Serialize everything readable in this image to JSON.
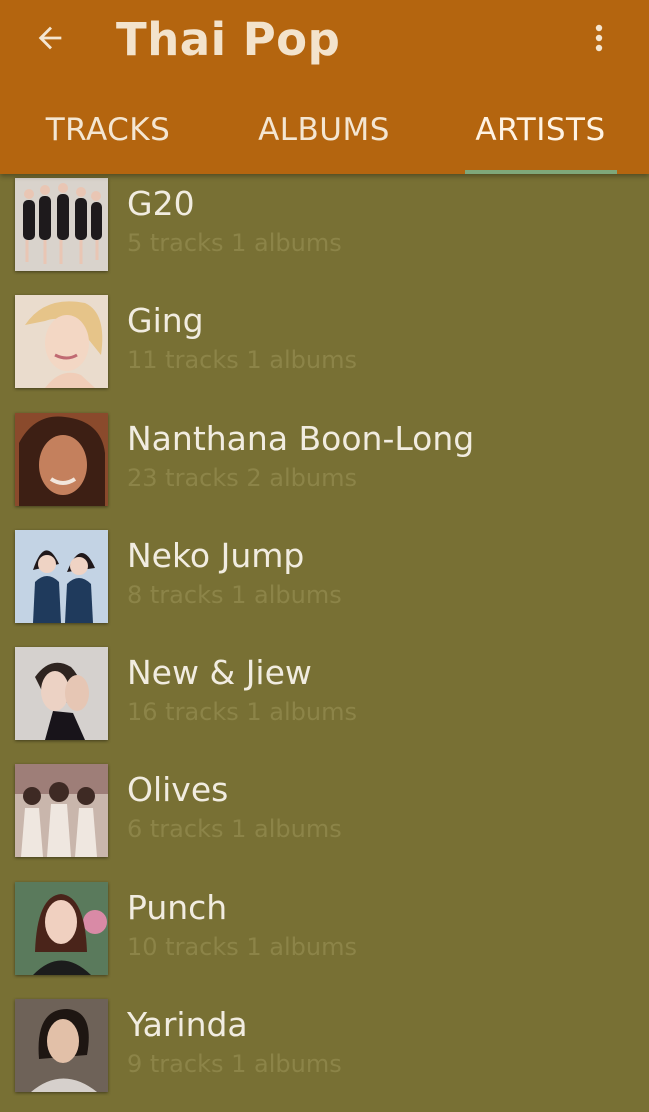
{
  "toolbar": {
    "title": "Thai Pop",
    "back_icon": "arrow-back-icon",
    "menu_icon": "more-vert-icon"
  },
  "tabs": [
    {
      "label": "TRACKS",
      "selected": false
    },
    {
      "label": "ALBUMS",
      "selected": false
    },
    {
      "label": "ARTISTS",
      "selected": true
    }
  ],
  "artists": [
    {
      "name": "G20",
      "subtitle": "5 tracks 1 albums",
      "thumb_color": "#d9d3cc"
    },
    {
      "name": "Ging",
      "subtitle": "11 tracks 1 albums",
      "thumb_color": "#eadccd"
    },
    {
      "name": "Nanthana Boon-Long",
      "subtitle": "23 tracks 2 albums",
      "thumb_color": "#8a4a2c"
    },
    {
      "name": "Neko Jump",
      "subtitle": "8 tracks 1 albums",
      "thumb_color": "#c3d3e4"
    },
    {
      "name": "New & Jiew",
      "subtitle": "16 tracks 1 albums",
      "thumb_color": "#d5d1ce"
    },
    {
      "name": "Olives",
      "subtitle": "6 tracks 1 albums",
      "thumb_color": "#c9b6ac"
    },
    {
      "name": "Punch",
      "subtitle": "10 tracks 1 albums",
      "thumb_color": "#5a7a5c"
    },
    {
      "name": "Yarinda",
      "subtitle": "9 tracks 1 albums",
      "thumb_color": "#6e6258"
    }
  ],
  "colors": {
    "appbar": "#b4650f",
    "background": "#787034",
    "indicator": "#7fa77a"
  }
}
